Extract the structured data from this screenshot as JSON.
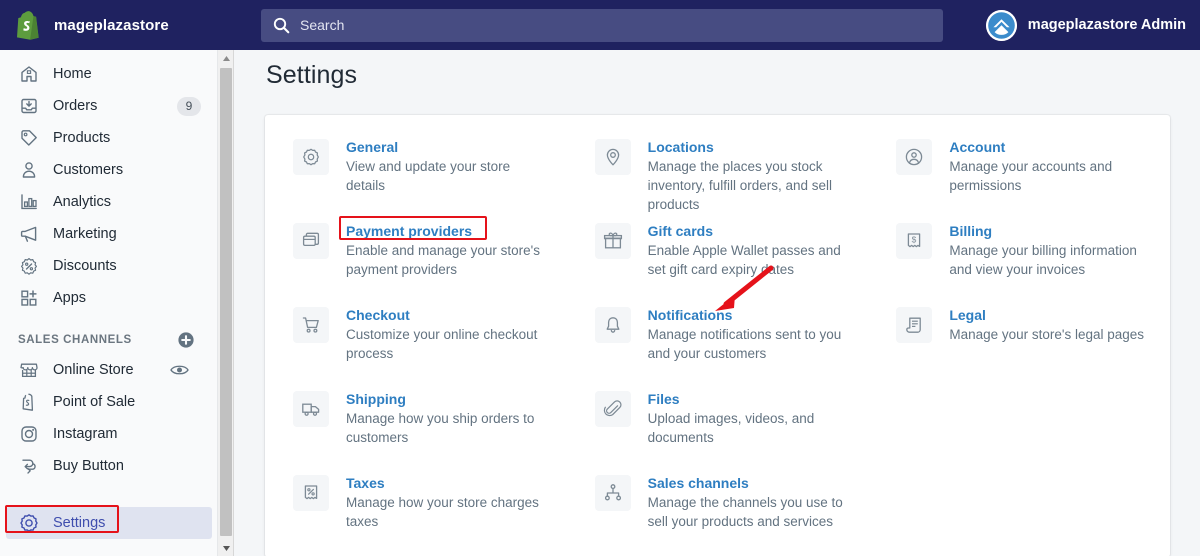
{
  "topbar": {
    "brand_name": "mageplazastore",
    "logo_icon": "shopify-bag-icon",
    "search": {
      "icon": "search-icon",
      "placeholder": "Search",
      "value": ""
    },
    "account": {
      "name": "mageplazastore Admin",
      "avatar_icon": "chevron-up-avatar-icon"
    },
    "colors": {
      "bar_bg": "#1f2260",
      "search_bg": "#474c82",
      "logo_green": "#5d9c3e"
    }
  },
  "sidebar": {
    "items": [
      {
        "label": "Home",
        "icon": "home-icon",
        "badge": ""
      },
      {
        "label": "Orders",
        "icon": "orders-inbox-icon",
        "badge": "9"
      },
      {
        "label": "Products",
        "icon": "products-tag-icon",
        "badge": ""
      },
      {
        "label": "Customers",
        "icon": "customers-person-icon",
        "badge": ""
      },
      {
        "label": "Analytics",
        "icon": "analytics-bars-icon",
        "badge": ""
      },
      {
        "label": "Marketing",
        "icon": "marketing-megaphone-icon",
        "badge": ""
      },
      {
        "label": "Discounts",
        "icon": "discounts-percent-icon",
        "badge": ""
      },
      {
        "label": "Apps",
        "icon": "apps-grid-plus-icon",
        "badge": ""
      }
    ],
    "section": {
      "title": "SALES CHANNELS",
      "add_icon": "plus-circle-icon"
    },
    "channels": [
      {
        "label": "Online Store",
        "icon": "online-store-icon",
        "trailing_icon": "eye-icon"
      },
      {
        "label": "Point of Sale",
        "icon": "point-of-sale-icon",
        "trailing_icon": ""
      },
      {
        "label": "Instagram",
        "icon": "instagram-icon",
        "trailing_icon": ""
      },
      {
        "label": "Buy Button",
        "icon": "buy-button-icon",
        "trailing_icon": ""
      }
    ],
    "settings": {
      "label": "Settings",
      "icon": "gear-icon",
      "selected": true,
      "highlight_color": "#e5121a"
    },
    "scrollbar": {
      "up_icon": "scroll-up-arrow-icon",
      "down_icon": "scroll-down-arrow-icon"
    }
  },
  "main": {
    "page_title": "Settings",
    "annotation": {
      "arrow_icon": "red-arrow-icon",
      "color": "#e5121a",
      "target": "Payment providers"
    },
    "settings_items": [
      {
        "title": "General",
        "desc": "View and update your store details",
        "icon": "gear-icon",
        "highlighted": false
      },
      {
        "title": "Locations",
        "desc": "Manage the places you stock inventory, fulfill orders, and sell products",
        "icon": "location-pin-icon",
        "highlighted": false
      },
      {
        "title": "Account",
        "desc": "Manage your accounts and permissions",
        "icon": "account-circle-icon",
        "highlighted": false
      },
      {
        "title": "Payment providers",
        "desc": "Enable and manage your store's payment providers",
        "icon": "payment-card-icon",
        "highlighted": true
      },
      {
        "title": "Gift cards",
        "desc": "Enable Apple Wallet passes and set gift card expiry dates",
        "icon": "gift-card-icon",
        "highlighted": false
      },
      {
        "title": "Billing",
        "desc": "Manage your billing information and view your invoices",
        "icon": "billing-receipt-icon",
        "highlighted": false
      },
      {
        "title": "Checkout",
        "desc": "Customize your online checkout process",
        "icon": "checkout-cart-icon",
        "highlighted": false
      },
      {
        "title": "Notifications",
        "desc": "Manage notifications sent to you and your customers",
        "icon": "bell-icon",
        "highlighted": false
      },
      {
        "title": "Legal",
        "desc": "Manage your store's legal pages",
        "icon": "legal-scroll-icon",
        "highlighted": false
      },
      {
        "title": "Shipping",
        "desc": "Manage how you ship orders to customers",
        "icon": "shipping-truck-icon",
        "highlighted": false
      },
      {
        "title": "Files",
        "desc": "Upload images, videos, and documents",
        "icon": "paperclip-icon",
        "highlighted": false
      },
      {
        "title": "",
        "desc": "",
        "icon": "",
        "highlighted": false
      },
      {
        "title": "Taxes",
        "desc": "Manage how your store charges taxes",
        "icon": "taxes-percent-receipt-icon",
        "highlighted": false
      },
      {
        "title": "Sales channels",
        "desc": "Manage the channels you use to sell your products and services",
        "icon": "sales-channels-node-icon",
        "highlighted": false
      },
      {
        "title": "",
        "desc": "",
        "icon": "",
        "highlighted": false
      }
    ]
  }
}
